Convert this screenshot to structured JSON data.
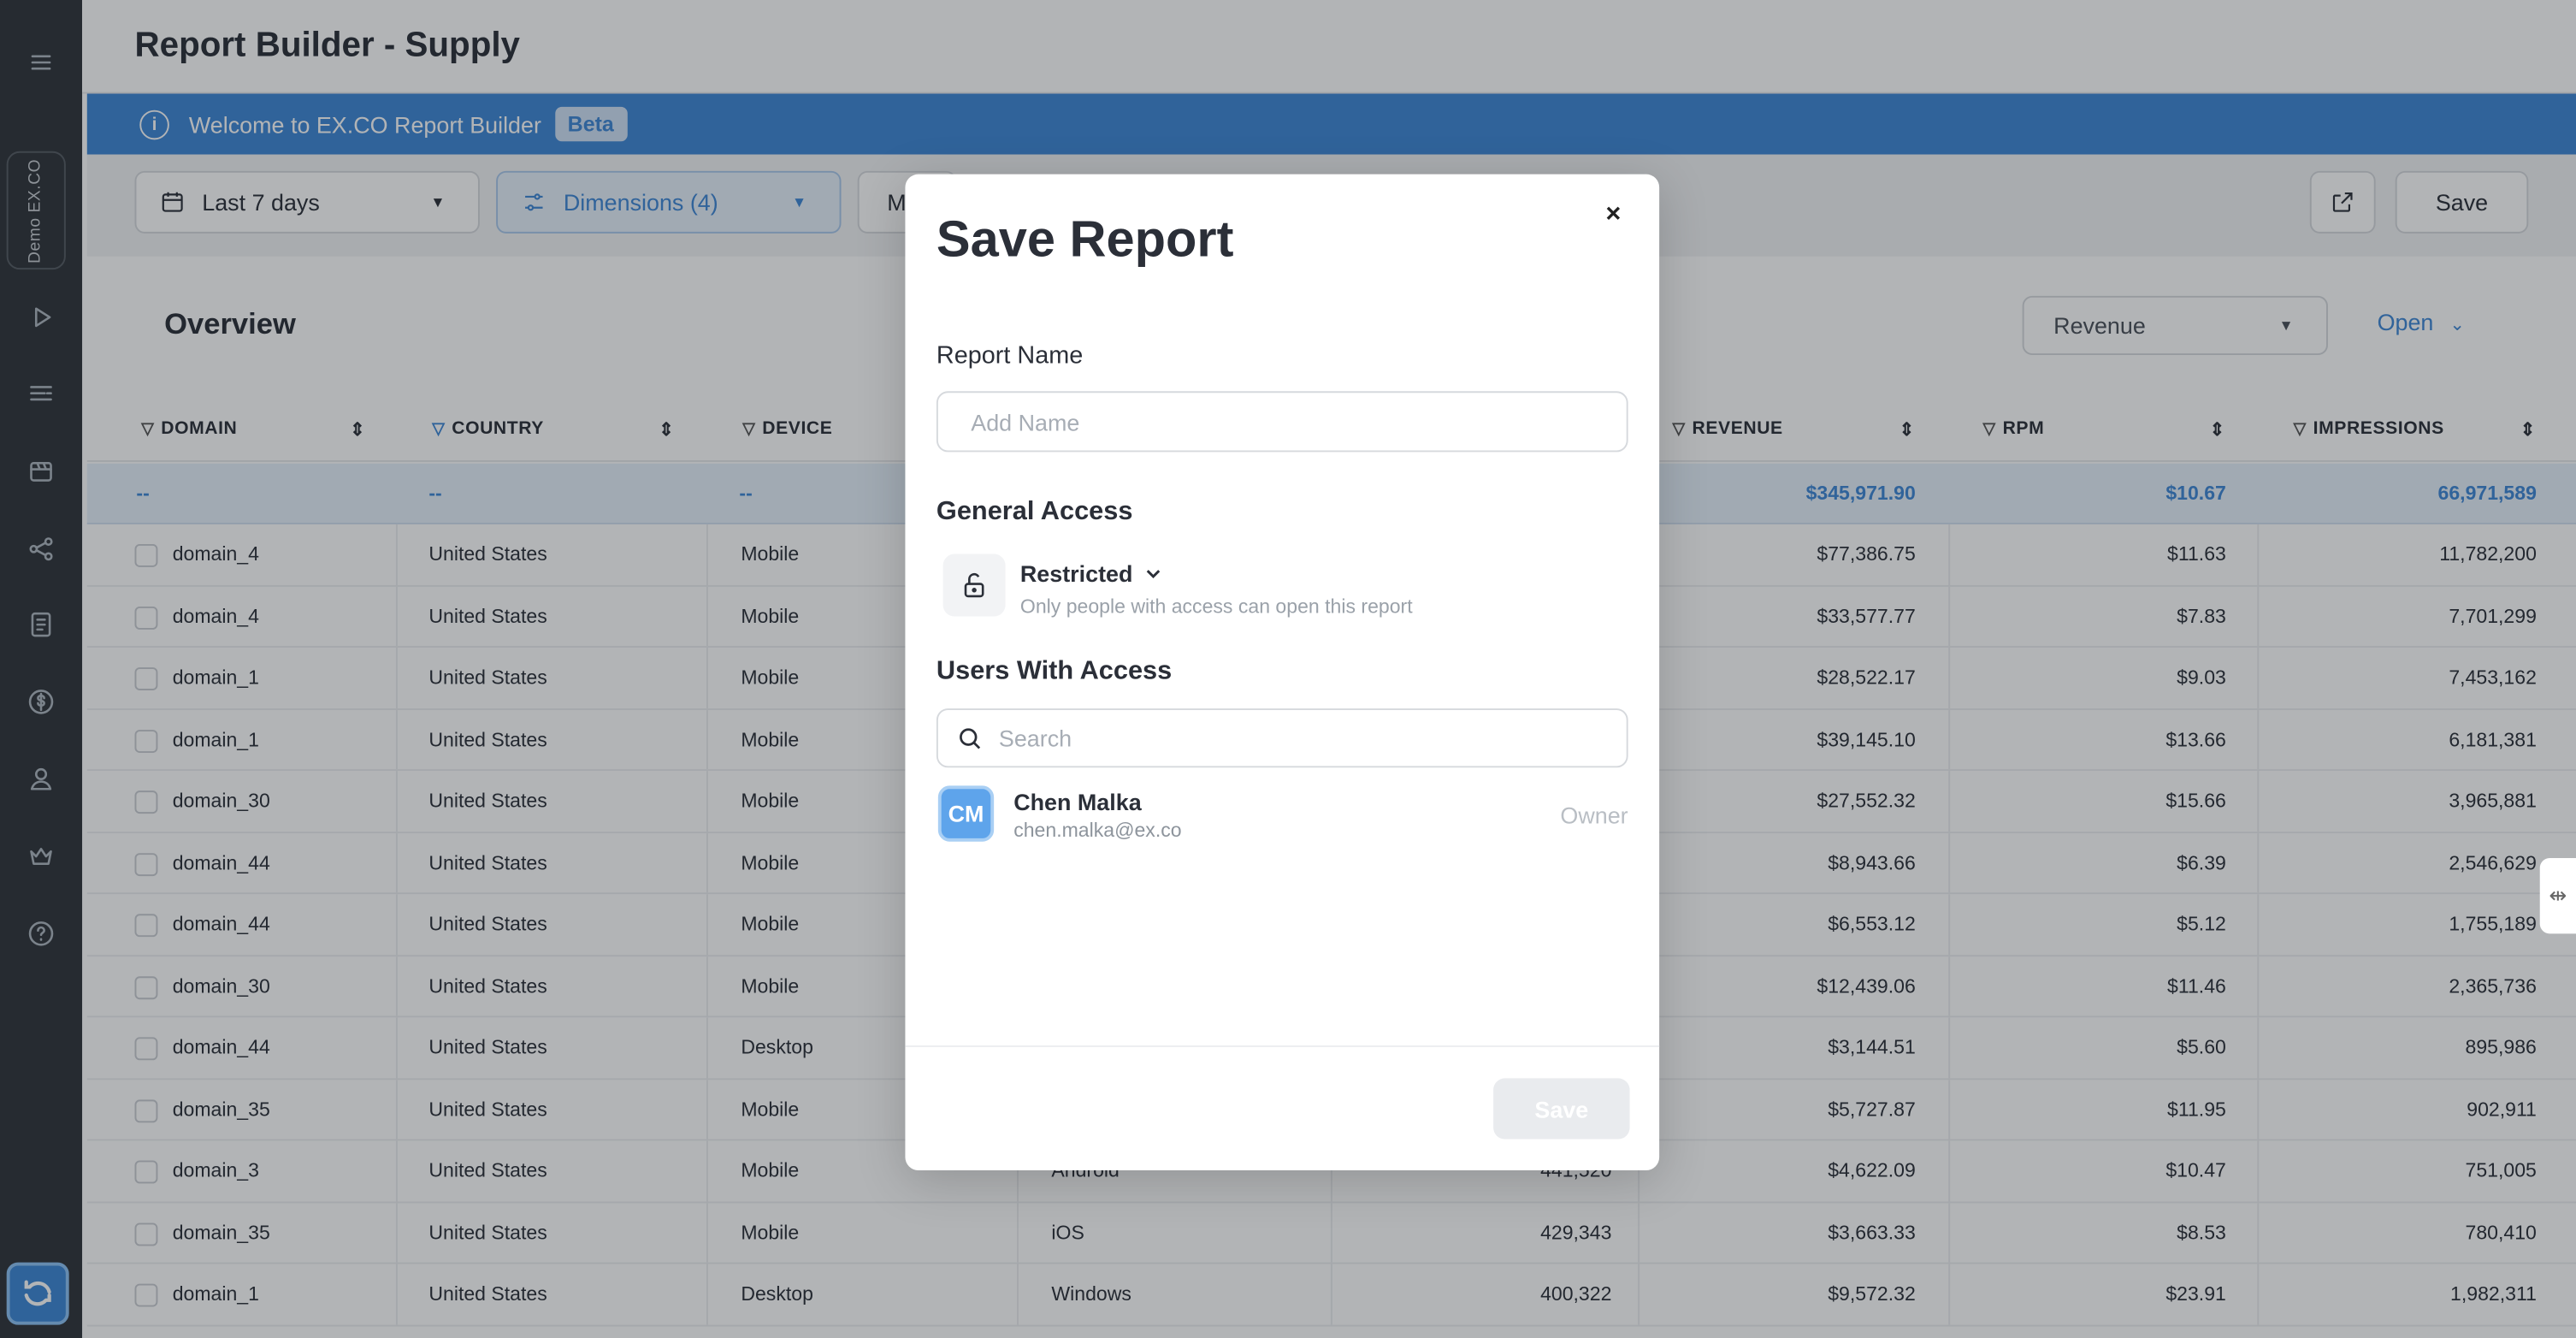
{
  "sidebar": {
    "workspace": "Demo EX.CO",
    "icons": [
      "menu-icon",
      "play-icon",
      "list-icon",
      "video-icon",
      "share-icon",
      "document-icon",
      "dollar-icon",
      "user-icon",
      "crown-icon",
      "help-icon"
    ]
  },
  "header": {
    "title": "Report Builder - Supply"
  },
  "banner": {
    "text": "Welcome to EX.CO Report Builder",
    "badge": "Beta"
  },
  "filters": {
    "date_range": "Last 7 days",
    "dimensions": "Dimensions (4)",
    "metrics_partial": "M",
    "save_label": "Save"
  },
  "overview": {
    "title": "Overview",
    "metric_select": "Revenue",
    "open_label": "Open"
  },
  "table": {
    "columns": {
      "domain": "DOMAIN",
      "country": "COUNTRY",
      "device": "DEVICE",
      "revenue": "REVENUE",
      "rpm": "RPM",
      "impressions": "IMPRESSIONS"
    },
    "totals": {
      "domain": "--",
      "country": "--",
      "device": "--",
      "revenue": "$345,971.90",
      "rpm": "$10.67",
      "impressions": "66,971,589"
    },
    "rows": [
      {
        "domain": "domain_4",
        "country": "United States",
        "device": "Mobile",
        "os": "",
        "requests": "",
        "revenue": "$77,386.75",
        "rpm": "$11.63",
        "impressions": "11,782,200"
      },
      {
        "domain": "domain_4",
        "country": "United States",
        "device": "Mobile",
        "os": "",
        "requests": "",
        "revenue": "$33,577.77",
        "rpm": "$7.83",
        "impressions": "7,701,299"
      },
      {
        "domain": "domain_1",
        "country": "United States",
        "device": "Mobile",
        "os": "",
        "requests": "",
        "revenue": "$28,522.17",
        "rpm": "$9.03",
        "impressions": "7,453,162"
      },
      {
        "domain": "domain_1",
        "country": "United States",
        "device": "Mobile",
        "os": "",
        "requests": "",
        "revenue": "$39,145.10",
        "rpm": "$13.66",
        "impressions": "6,181,381"
      },
      {
        "domain": "domain_30",
        "country": "United States",
        "device": "Mobile",
        "os": "",
        "requests": "",
        "revenue": "$27,552.32",
        "rpm": "$15.66",
        "impressions": "3,965,881"
      },
      {
        "domain": "domain_44",
        "country": "United States",
        "device": "Mobile",
        "os": "",
        "requests": "",
        "revenue": "$8,943.66",
        "rpm": "$6.39",
        "impressions": "2,546,629"
      },
      {
        "domain": "domain_44",
        "country": "United States",
        "device": "Mobile",
        "os": "",
        "requests": "",
        "revenue": "$6,553.12",
        "rpm": "$5.12",
        "impressions": "1,755,189"
      },
      {
        "domain": "domain_30",
        "country": "United States",
        "device": "Mobile",
        "os": "",
        "requests": "",
        "revenue": "$12,439.06",
        "rpm": "$11.46",
        "impressions": "2,365,736"
      },
      {
        "domain": "domain_44",
        "country": "United States",
        "device": "Desktop",
        "os": "",
        "requests": "",
        "revenue": "$3,144.51",
        "rpm": "$5.60",
        "impressions": "895,986"
      },
      {
        "domain": "domain_35",
        "country": "United States",
        "device": "Mobile",
        "os": "",
        "requests": "",
        "revenue": "$5,727.87",
        "rpm": "$11.95",
        "impressions": "902,911"
      },
      {
        "domain": "domain_3",
        "country": "United States",
        "device": "Mobile",
        "os": "Android",
        "requests": "441,520",
        "revenue": "$4,622.09",
        "rpm": "$10.47",
        "impressions": "751,005"
      },
      {
        "domain": "domain_35",
        "country": "United States",
        "device": "Mobile",
        "os": "iOS",
        "requests": "429,343",
        "revenue": "$3,663.33",
        "rpm": "$8.53",
        "impressions": "780,410"
      },
      {
        "domain": "domain_1",
        "country": "United States",
        "device": "Desktop",
        "os": "Windows",
        "requests": "400,322",
        "revenue": "$9,572.32",
        "rpm": "$23.91",
        "impressions": "1,982,311"
      }
    ]
  },
  "modal": {
    "title": "Save Report",
    "close": "×",
    "name_label": "Report Name",
    "name_placeholder": "Add Name",
    "access_section": "General Access",
    "access_level": "Restricted",
    "access_desc": "Only people with access can open this report",
    "users_section": "Users With Access",
    "search_placeholder": "Search",
    "users": [
      {
        "initials": "CM",
        "name": "Chen Malka",
        "email": "chen.malka@ex.co",
        "role": "Owner"
      }
    ],
    "save_label": "Save"
  },
  "colors": {
    "accent": "#3e86d6",
    "sidebar": "#2f3439",
    "avatar": "#5ea4eb"
  }
}
